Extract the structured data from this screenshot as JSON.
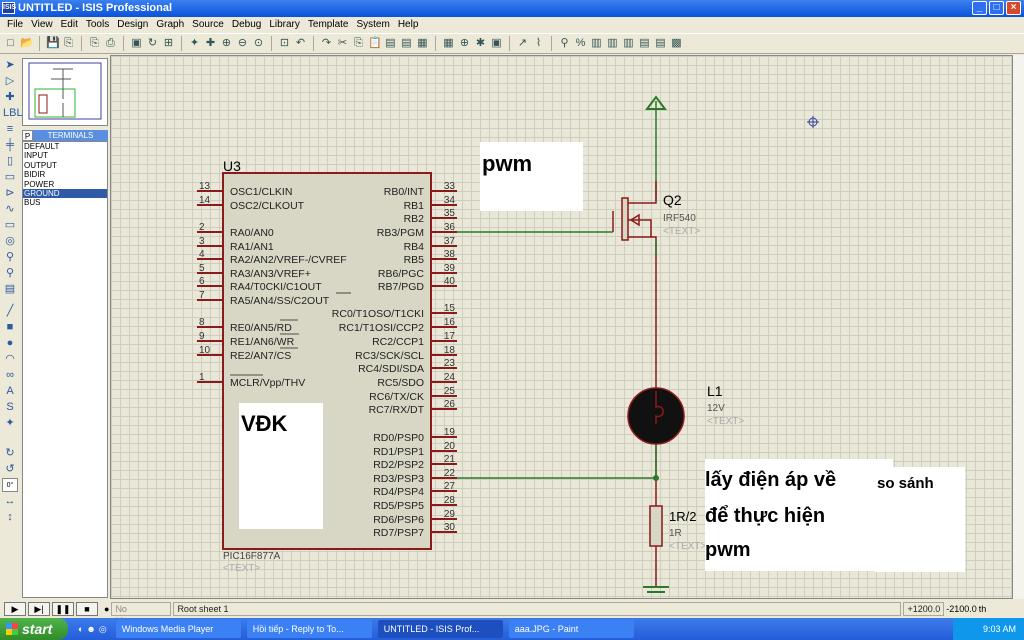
{
  "window": {
    "title": "UNTITLED - ISIS Professional",
    "app_icon": "ISIS"
  },
  "menu": [
    "File",
    "View",
    "Edit",
    "Tools",
    "Design",
    "Graph",
    "Source",
    "Debug",
    "Library",
    "Template",
    "System",
    "Help"
  ],
  "toolbar_icons": [
    "new",
    "open",
    "save",
    "import",
    "export",
    "print",
    "print-area",
    "refresh",
    "grid",
    "origin",
    "pan",
    "zoom-in",
    "zoom-out",
    "zoom-all",
    "zoom-area",
    "undo",
    "redo",
    "cut",
    "copy",
    "paste",
    "block-copy",
    "block-move",
    "block-rotate",
    "block-delete",
    "pick",
    "make-device",
    "packaging",
    "decompose",
    "wire-autorouter",
    "search",
    "property-assign",
    "new-sheet",
    "remove-sheet",
    "goto-sheet",
    "bill-of-materials",
    "electrical-rule-check",
    "netlist"
  ],
  "left_tools": [
    "selection",
    "component",
    "junction",
    "wire-label",
    "text-script",
    "buses",
    "subcircuit",
    "terminals",
    "pin",
    "graph",
    "tape",
    "generator",
    "probe-voltage",
    "probe-current",
    "instrument",
    "line",
    "box",
    "circle",
    "arc",
    "path",
    "text",
    "symbol",
    "marker",
    "rotate-cw",
    "rotate-ccw",
    "angle",
    "mirror-x",
    "mirror-y"
  ],
  "rotation_value": "0°",
  "panel": {
    "mode": "P",
    "title": "TERMINALS",
    "items": [
      "DEFAULT",
      "INPUT",
      "OUTPUT",
      "BIDIR",
      "POWER",
      "GROUND",
      "BUS"
    ],
    "selected": "GROUND"
  },
  "schematic": {
    "u3": {
      "ref": "U3",
      "part": "PIC16F877A",
      "text": "<TEXT>",
      "left_pins": [
        [
          "13",
          "OSC1/CLKIN"
        ],
        [
          "14",
          "OSC2/CLKOUT"
        ],
        [
          "2",
          "RA0/AN0"
        ],
        [
          "3",
          "RA1/AN1"
        ],
        [
          "4",
          "RA2/AN2/VREF-/CVREF"
        ],
        [
          "5",
          "RA3/AN3/VREF+"
        ],
        [
          "6",
          "RA4/T0CKI/C1OUT"
        ],
        [
          "7",
          "RA5/AN4/SS/C2OUT"
        ],
        [
          "8",
          "RE0/AN5/RD"
        ],
        [
          "9",
          "RE1/AN6/WR"
        ],
        [
          "10",
          "RE2/AN7/CS"
        ],
        [
          "1",
          "MCLR/Vpp/THV"
        ]
      ],
      "right_pins": [
        [
          "33",
          "RB0/INT"
        ],
        [
          "34",
          "RB1"
        ],
        [
          "35",
          "RB2"
        ],
        [
          "36",
          "RB3/PGM"
        ],
        [
          "37",
          "RB4"
        ],
        [
          "38",
          "RB5"
        ],
        [
          "39",
          "RB6/PGC"
        ],
        [
          "40",
          "RB7/PGD"
        ],
        [
          "15",
          "RC0/T1OSO/T1CKI"
        ],
        [
          "16",
          "RC1/T1OSI/CCP2"
        ],
        [
          "17",
          "RC2/CCP1"
        ],
        [
          "18",
          "RC3/SCK/SCL"
        ],
        [
          "23",
          "RC4/SDI/SDA"
        ],
        [
          "24",
          "RC5/SDO"
        ],
        [
          "25",
          "RC6/TX/CK"
        ],
        [
          "26",
          "RC7/RX/DT"
        ],
        [
          "19",
          "RD0/PSP0"
        ],
        [
          "20",
          "RD1/PSP1"
        ],
        [
          "21",
          "RD2/PSP2"
        ],
        [
          "22",
          "RD3/PSP3"
        ],
        [
          "27",
          "RD4/PSP4"
        ],
        [
          "28",
          "RD5/PSP5"
        ],
        [
          "29",
          "RD6/PSP6"
        ],
        [
          "30",
          "RD7/PSP7"
        ]
      ]
    },
    "q2": {
      "ref": "Q2",
      "part": "IRF540",
      "text": "<TEXT>"
    },
    "l1": {
      "ref": "L1",
      "value": "12V",
      "text": "<TEXT>"
    },
    "r": {
      "ref": "1R/2",
      "value": "1R",
      "text": "<TEXT>"
    },
    "notes": {
      "pwm": "pwm",
      "vdk": "VĐK",
      "feedback_1": "lấy điện áp về",
      "feedback_1b": "so sánh",
      "feedback_2": "để thực hiện",
      "feedback_3": "pwm"
    }
  },
  "status": {
    "messages": "No Messages",
    "sheet": "Root sheet 1",
    "x": "+1200.0",
    "y": "-2100.0",
    "unit": "th"
  },
  "taskbar": {
    "start": "start",
    "tasks": [
      "Windows Media Player",
      "Hồi tiếp - Reply to To...",
      "UNTITLED - ISIS Prof...",
      "aaa.JPG - Paint"
    ],
    "active": 2,
    "clock": "9:03 AM"
  },
  "colors": {
    "wire": "#2a7a2a",
    "component": "#8b1a1a",
    "grid_bg": "#e9e7d7",
    "title_bar": "#0a52d8"
  }
}
